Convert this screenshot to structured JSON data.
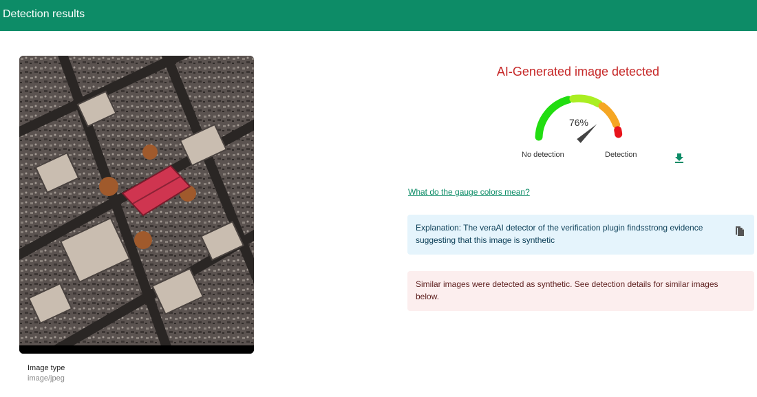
{
  "header": {
    "title": "Detection results"
  },
  "image": {
    "type_label": "Image type",
    "type_value": "image/jpeg"
  },
  "result": {
    "verdict": "AI-Generated image detected",
    "gauge_percent": 76,
    "gauge_text": "76%",
    "gauge_label_left": "No detection",
    "gauge_label_right": "Detection",
    "help_link": "What do the gauge colors mean?",
    "explanation": "Explanation: The veraAI detector of the verification plugin findsstrong evidence suggesting that this image is synthetic",
    "similar_images": "Similar images were detected as synthetic. See detection details for similar images below."
  },
  "colors": {
    "accent": "#0d8c67",
    "verdict": "#c62828",
    "gauge_segments": [
      "#22dd11",
      "#aaee22",
      "#f5a623",
      "#e8141b"
    ]
  },
  "icons": {
    "download": "download-icon",
    "copy": "copy-icon"
  }
}
